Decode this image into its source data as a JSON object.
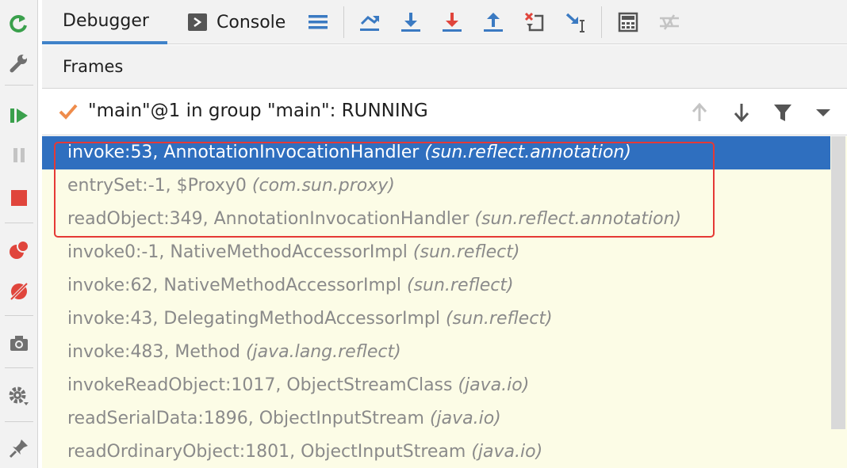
{
  "side_toolbar": {
    "icons": [
      "rerun-icon",
      "wrench-icon",
      "resume-icon",
      "pause-icon",
      "stop-icon",
      "view-breakpoints-icon",
      "mute-breakpoints-icon",
      "camera-icon",
      "settings-icon",
      "pin-icon"
    ]
  },
  "tabs": [
    {
      "label": "Debugger"
    },
    {
      "label": "Console"
    }
  ],
  "toolbar_icons": [
    "menu-icon",
    "show-execution-point-icon",
    "step-over-icon",
    "step-into-icon",
    "step-out-icon",
    "drop-frame-icon",
    "run-to-cursor-icon",
    "evaluate-expression-icon",
    "trace-icon"
  ],
  "frames": {
    "header": "Frames",
    "thread": "\"main\"@1 in group \"main\": RUNNING",
    "items": [
      {
        "method": "invoke:53, AnnotationInvocationHandler",
        "pkg": "(sun.reflect.annotation)",
        "selected": true
      },
      {
        "method": "entrySet:-1, $Proxy0",
        "pkg": "(com.sun.proxy)"
      },
      {
        "method": "readObject:349, AnnotationInvocationHandler",
        "pkg": "(sun.reflect.annotation)"
      },
      {
        "method": "invoke0:-1, NativeMethodAccessorImpl",
        "pkg": "(sun.reflect)"
      },
      {
        "method": "invoke:62, NativeMethodAccessorImpl",
        "pkg": "(sun.reflect)"
      },
      {
        "method": "invoke:43, DelegatingMethodAccessorImpl",
        "pkg": "(sun.reflect)"
      },
      {
        "method": "invoke:483, Method",
        "pkg": "(java.lang.reflect)"
      },
      {
        "method": "invokeReadObject:1017, ObjectStreamClass",
        "pkg": "(java.io)"
      },
      {
        "method": "readSerialData:1896, ObjectInputStream",
        "pkg": "(java.io)"
      },
      {
        "method": "readOrdinaryObject:1801, ObjectInputStream",
        "pkg": "(java.io)"
      }
    ]
  },
  "colors": {
    "accent": "#4083c9",
    "selected_row": "#2f6fbf",
    "list_bg": "#fcfce6",
    "highlight": "#e53935"
  }
}
